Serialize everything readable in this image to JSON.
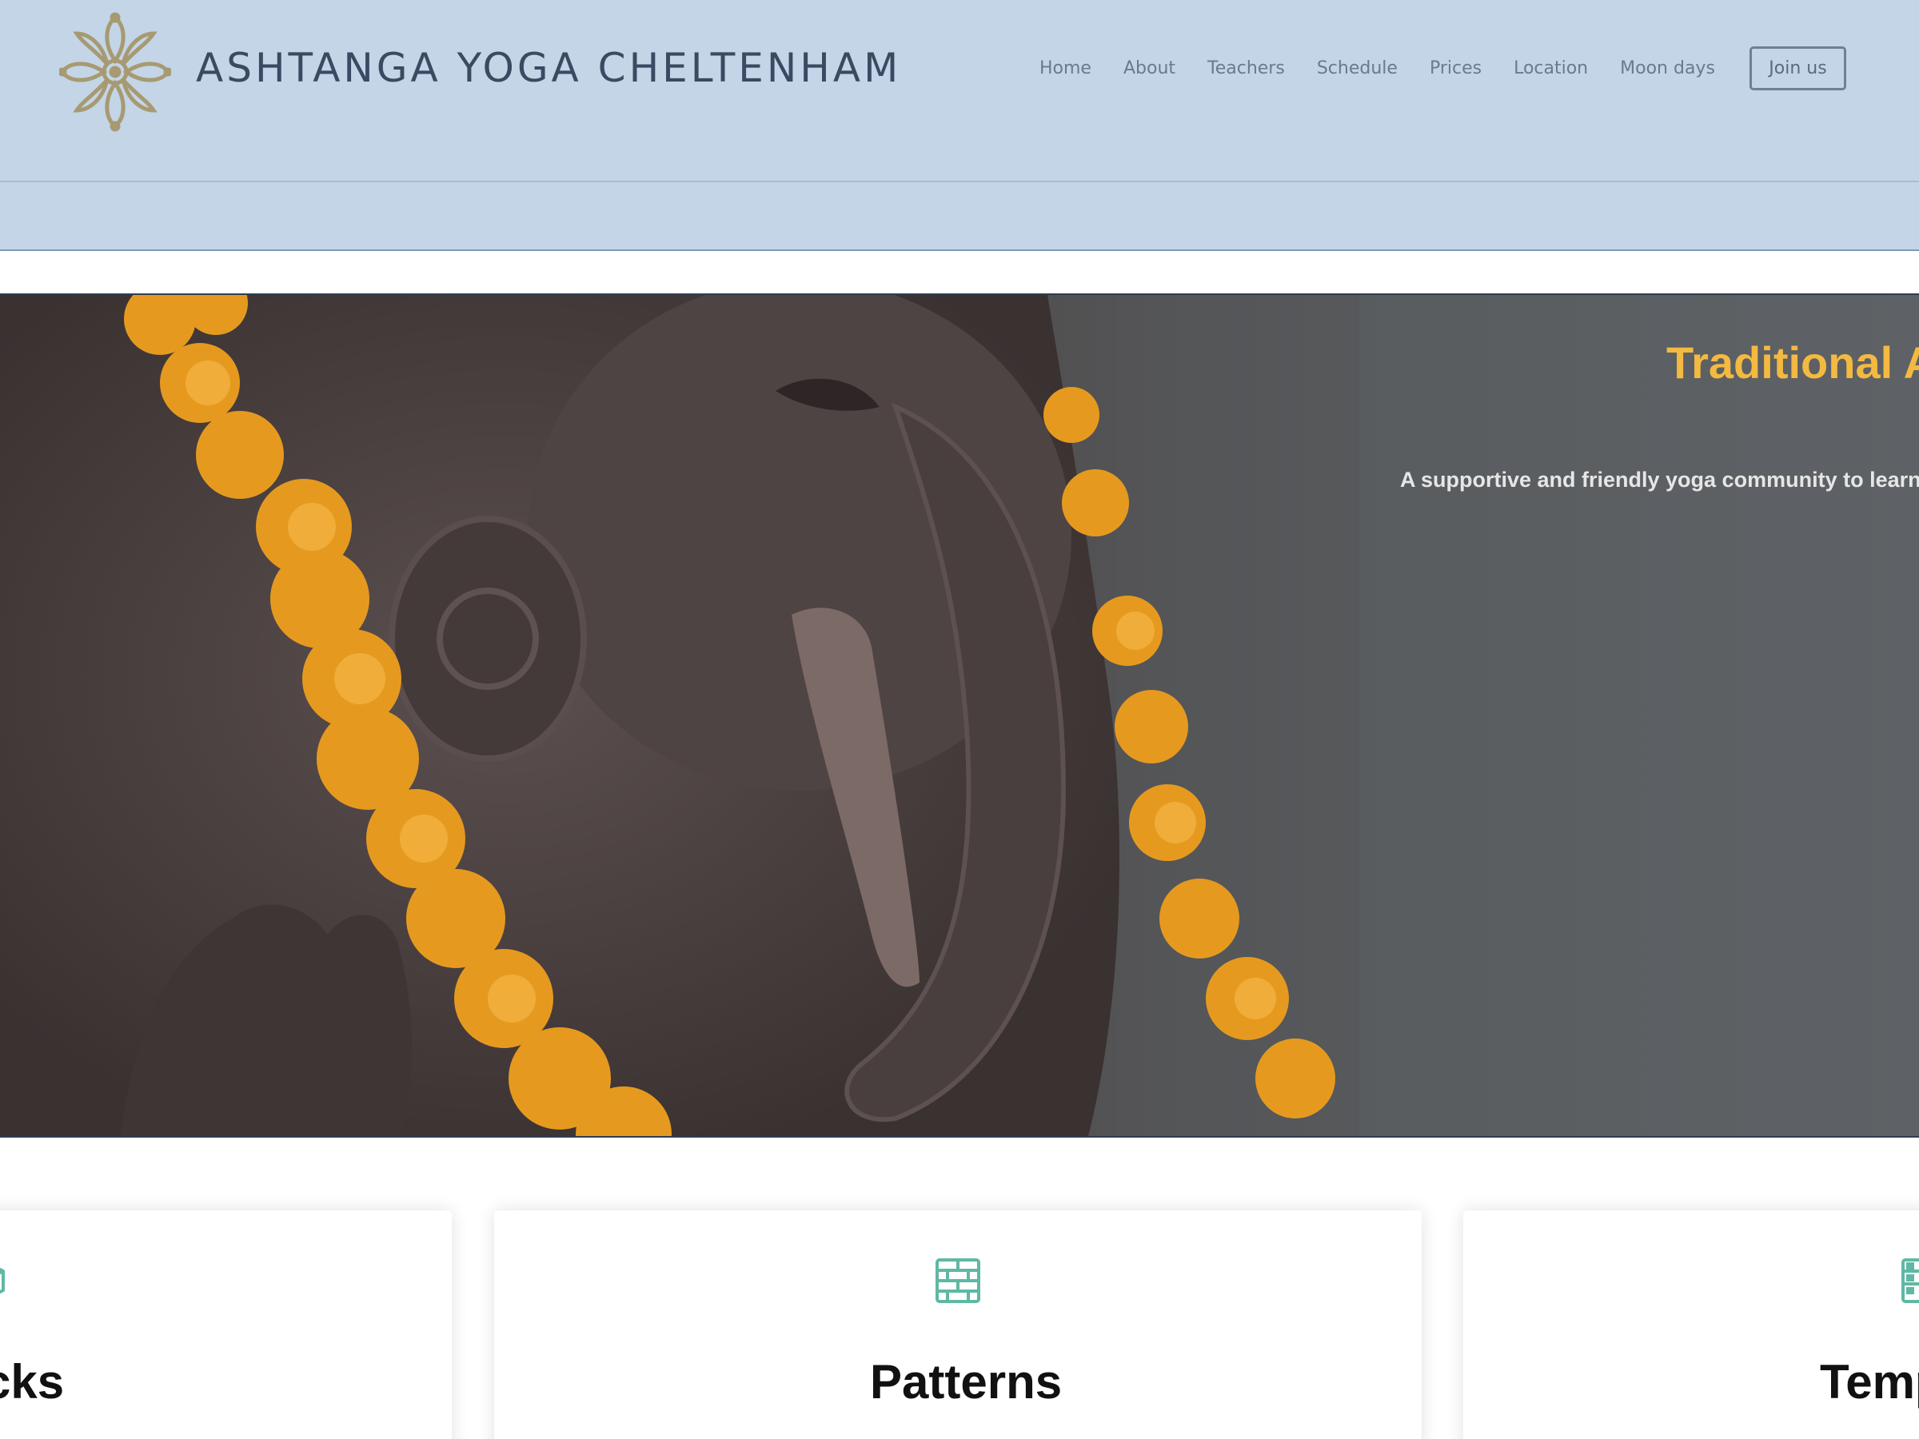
{
  "header": {
    "site_title": "ASHTANGA YOGA CHELTENHAM",
    "nav": [
      "Home",
      "About",
      "Teachers",
      "Schedule",
      "Prices",
      "Location",
      "Moon days"
    ],
    "join_label": "Join us"
  },
  "hero": {
    "title": "Traditional A",
    "subtitle": "A supportive and friendly yoga community to learn"
  },
  "cards": [
    {
      "title": "cks",
      "icon": "cube-icon"
    },
    {
      "title": "Patterns",
      "icon": "brick-wall-icon"
    },
    {
      "title": "Temp",
      "icon": "template-icon"
    }
  ],
  "colors": {
    "header_bg": "#c3d5e6",
    "hero_title": "#f3b941",
    "icon_accent": "#5fb8a4"
  }
}
